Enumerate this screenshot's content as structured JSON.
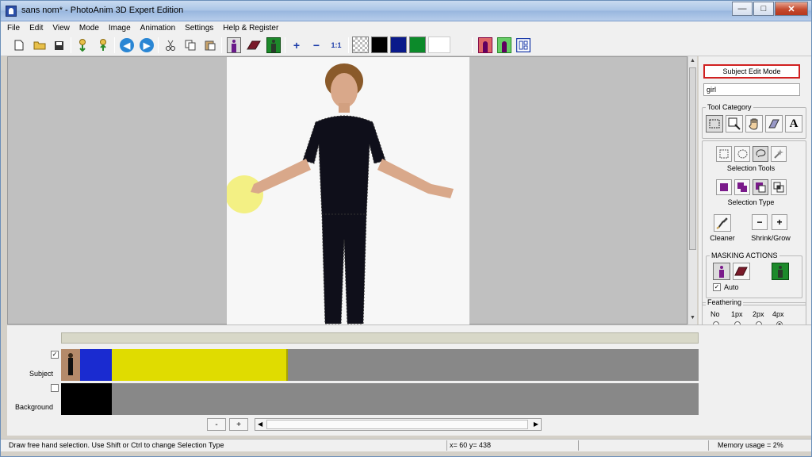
{
  "window": {
    "title": "sans nom* - PhotoAnim 3D Expert Edition",
    "minimize": "—",
    "maximize": "□",
    "close": "✕"
  },
  "menu": [
    "File",
    "Edit",
    "View",
    "Mode",
    "Image",
    "Animation",
    "Settings",
    "Help & Register"
  ],
  "toolbar": {
    "zoom_in": "+",
    "zoom_out": "−",
    "actual_size": "1:1",
    "colors": {
      "black": "#000000",
      "navy": "#0a1a8a",
      "green": "#0c8a2a",
      "white": "#ffffff"
    }
  },
  "panel": {
    "mode_button": "Subject Edit Mode",
    "subject_name": "girl",
    "tool_category_title": "Tool Category",
    "selection_tools_caption": "Selection Tools",
    "selection_type_caption": "Selection Type",
    "cleaner_caption": "Cleaner",
    "shrink_grow_caption": "Shrink/Grow",
    "shrink": "−",
    "grow": "+",
    "masking_title": "MASKING ACTIONS",
    "auto_label": "Auto",
    "auto_checked": true,
    "feathering_title": "Feathering",
    "feathering_options": [
      "No",
      "1px",
      "2px",
      "4px"
    ],
    "feathering_selected": "4px"
  },
  "timeline": {
    "tracks": [
      {
        "label": "Subject",
        "checked": true,
        "clip_colors": [
          "#1a2bd0",
          "#e0dc00"
        ]
      },
      {
        "label": "Background",
        "checked": false,
        "clip_colors": [
          "#000000"
        ]
      }
    ],
    "zoom_out": "-",
    "zoom_in": "+"
  },
  "status": {
    "hint": "Draw free hand selection. Use Shift or Ctrl to change Selection Type",
    "coords": "x= 60 y= 438",
    "memory": "Memory usage = 2%"
  }
}
